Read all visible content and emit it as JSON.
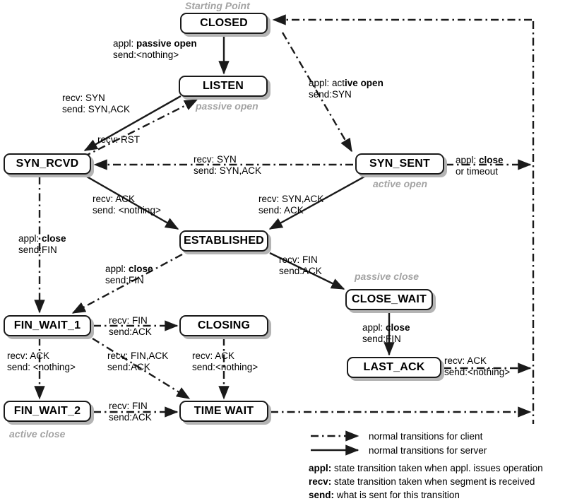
{
  "diagram": {
    "title": "TCP State Transition Diagram",
    "colors": {
      "line": "#1a1a1a",
      "box_border": "#1a1a1a",
      "box_fill": "#ffffff",
      "box_shadow": "#b4b4b4",
      "annotation": "#a3a3a3",
      "text": "#000000"
    }
  },
  "states": [
    {
      "id": "closed",
      "label": "CLOSED"
    },
    {
      "id": "listen",
      "label": "LISTEN"
    },
    {
      "id": "syn_rcvd",
      "label": "SYN_RCVD"
    },
    {
      "id": "syn_sent",
      "label": "SYN_SENT"
    },
    {
      "id": "established",
      "label": "ESTABLISHED"
    },
    {
      "id": "close_wait",
      "label": "CLOSE_WAIT"
    },
    {
      "id": "last_ack",
      "label": "LAST_ACK"
    },
    {
      "id": "fin_wait_1",
      "label": "FIN_WAIT_1"
    },
    {
      "id": "fin_wait_2",
      "label": "FIN_WAIT_2"
    },
    {
      "id": "closing",
      "label": "CLOSING"
    },
    {
      "id": "time_wait",
      "label": "TIME WAIT"
    }
  ],
  "annotations": [
    {
      "id": "starting-point",
      "text": "Starting Point"
    },
    {
      "id": "passive-open",
      "text": "passive open"
    },
    {
      "id": "active-open",
      "text": "active open"
    },
    {
      "id": "passive-close",
      "text": "passive close"
    },
    {
      "id": "active-close",
      "text": "active close"
    }
  ],
  "transitions": [
    {
      "id": "closed-to-listen",
      "from": "CLOSED",
      "to": "LISTEN",
      "kind": "server",
      "line1_prefix": "appl: ",
      "line1_bold": "passive open",
      "line1_suffix": "",
      "line2": "send:<nothing>"
    },
    {
      "id": "closed-to-syn-sent",
      "from": "CLOSED",
      "to": "SYN_SENT",
      "kind": "client",
      "line1_prefix": "appl: act",
      "line1_bold": "ive open",
      "line1_suffix": "",
      "line2": "send:SYN"
    },
    {
      "id": "listen-to-syn-rcvd",
      "from": "LISTEN",
      "to": "SYN_RCVD",
      "kind": "server",
      "line1_prefix": "recv: SYN",
      "line1_bold": "",
      "line1_suffix": "",
      "line2": "send: SYN,ACK"
    },
    {
      "id": "syn-rcvd-to-listen",
      "from": "SYN_RCVD",
      "to": "LISTEN",
      "kind": "client",
      "line1_prefix": "recv: RST",
      "line1_bold": "",
      "line1_suffix": "",
      "line2": ""
    },
    {
      "id": "syn-sent-to-syn-rcvd",
      "from": "SYN_SENT",
      "to": "SYN_RCVD",
      "kind": "client",
      "line1_prefix": "recv: SYN",
      "line1_bold": "",
      "line1_suffix": "",
      "line2": "send: SYN,ACK"
    },
    {
      "id": "syn-rcvd-to-established",
      "from": "SYN_RCVD",
      "to": "ESTABLISHED",
      "kind": "server",
      "line1_prefix": "recv: ACK",
      "line1_bold": "",
      "line1_suffix": "",
      "line2": "send: <nothing>"
    },
    {
      "id": "syn-sent-to-established",
      "from": "SYN_SENT",
      "to": "ESTABLISHED",
      "kind": "server",
      "line1_prefix": "recv: SYN,ACK",
      "line1_bold": "",
      "line1_suffix": "",
      "line2": "send: ACK"
    },
    {
      "id": "syn-sent-to-closed",
      "from": "SYN_SENT",
      "to": "CLOSED",
      "kind": "client",
      "line1_prefix": "appl: ",
      "line1_bold": "close",
      "line1_suffix": "",
      "line2": "or timeout"
    },
    {
      "id": "syn-rcvd-to-fin-wait-1",
      "from": "SYN_RCVD",
      "to": "FIN_WAIT_1",
      "kind": "client",
      "line1_prefix": "appl: ",
      "line1_bold": "close",
      "line1_suffix": "",
      "line2": "send:FIN"
    },
    {
      "id": "established-to-fin-wait-1",
      "from": "ESTABLISHED",
      "to": "FIN_WAIT_1",
      "kind": "client",
      "line1_prefix": "appl: ",
      "line1_bold": "close",
      "line1_suffix": "",
      "line2": "send:FIN"
    },
    {
      "id": "established-to-close-wait",
      "from": "ESTABLISHED",
      "to": "CLOSE_WAIT",
      "kind": "server",
      "line1_prefix": "recv: FIN",
      "line1_bold": "",
      "line1_suffix": "",
      "line2": "send:ACK"
    },
    {
      "id": "close-wait-to-last-ack",
      "from": "CLOSE_WAIT",
      "to": "LAST_ACK",
      "kind": "server",
      "line1_prefix": "appl: ",
      "line1_bold": "close",
      "line1_suffix": "",
      "line2": "send:FIN"
    },
    {
      "id": "last-ack-to-closed",
      "from": "LAST_ACK",
      "to": "CLOSED",
      "kind": "client",
      "line1_prefix": "recv: ACK",
      "line1_bold": "",
      "line1_suffix": "",
      "line2": "send:<nothing>"
    },
    {
      "id": "fin-wait-1-to-closing",
      "from": "FIN_WAIT_1",
      "to": "CLOSING",
      "kind": "client",
      "line1_prefix": "recv: FIN",
      "line1_bold": "",
      "line1_suffix": "",
      "line2": "send:ACK"
    },
    {
      "id": "fin-wait-1-to-fin-wait-2",
      "from": "FIN_WAIT_1",
      "to": "FIN_WAIT_2",
      "kind": "client",
      "line1_prefix": "recv: ACK",
      "line1_bold": "",
      "line1_suffix": "",
      "line2": "send: <nothing>"
    },
    {
      "id": "fin-wait-1-to-time-wait",
      "from": "FIN_WAIT_1",
      "to": "TIME WAIT",
      "kind": "client",
      "line1_prefix": "recv: FIN,ACK",
      "line1_bold": "",
      "line1_suffix": "",
      "line2": "send:ACK"
    },
    {
      "id": "closing-to-time-wait",
      "from": "CLOSING",
      "to": "TIME WAIT",
      "kind": "client",
      "line1_prefix": "recv: ACK",
      "line1_bold": "",
      "line1_suffix": "",
      "line2": "send:<nothing>"
    },
    {
      "id": "fin-wait-2-to-time-wait",
      "from": "FIN_WAIT_2",
      "to": "TIME WAIT",
      "kind": "client",
      "line1_prefix": "recv: FIN",
      "line1_bold": "",
      "line1_suffix": "",
      "line2": "send:ACK"
    }
  ],
  "legend": {
    "keys": [
      {
        "id": "client-line",
        "style": "dashdot",
        "text": "normal transitions for client"
      },
      {
        "id": "server-line",
        "style": "solid",
        "text": "normal transitions for server"
      }
    ],
    "definitions": [
      {
        "id": "appl",
        "term": "appl:",
        "desc": " state transition taken when appl. issues operation"
      },
      {
        "id": "recv",
        "term": "recv:",
        "desc": " state transition taken when segment is received"
      },
      {
        "id": "send",
        "term": "send:",
        "desc": " what is sent for this transition"
      }
    ]
  }
}
